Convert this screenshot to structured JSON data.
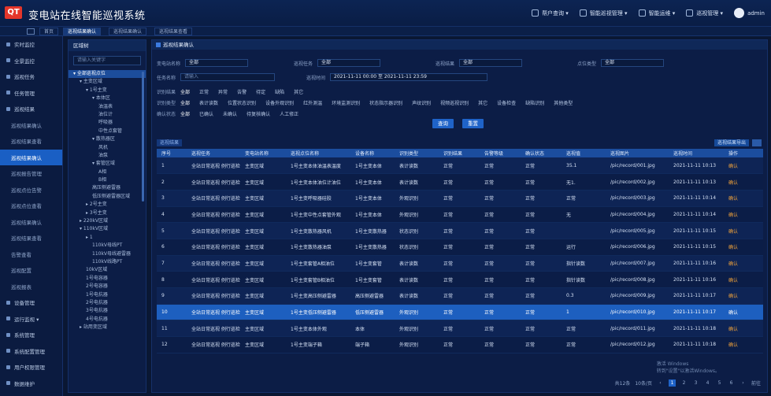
{
  "app": {
    "title": "变电站在线智能巡视系统",
    "logo_text": "QT"
  },
  "topbar": {
    "items": [
      {
        "label": "帮户查询 ▾",
        "icon": "user-icon"
      },
      {
        "label": "智能巡视管理 ▾",
        "icon": "monitor-icon"
      },
      {
        "label": "智能运维 ▾",
        "icon": "tool-icon"
      },
      {
        "label": "巡视管理 ▾",
        "icon": "list-icon"
      }
    ],
    "user": "admin"
  },
  "tabs": [
    "首页",
    "巡视结果确认",
    "巡视结果确认",
    "巡视结果查看"
  ],
  "sidebar": {
    "items": [
      {
        "label": "实时监控",
        "sub": false
      },
      {
        "label": "全景监控",
        "sub": false
      },
      {
        "label": "巡视任务",
        "sub": false
      },
      {
        "label": "任务管理",
        "sub": false
      },
      {
        "label": "巡视结果",
        "sub": false
      },
      {
        "label": "巡视结果确认",
        "sub": true
      },
      {
        "label": "巡视结果查看",
        "sub": true
      },
      {
        "label": "巡视结果确认",
        "sub": true,
        "active": true
      },
      {
        "label": "巡视报告管理",
        "sub": true
      },
      {
        "label": "巡视点位告警",
        "sub": true
      },
      {
        "label": "巡视点位查看",
        "sub": true
      },
      {
        "label": "巡视结果确认",
        "sub": true
      },
      {
        "label": "巡视结果查看",
        "sub": true
      },
      {
        "label": "告警查看",
        "sub": true
      },
      {
        "label": "巡视配置",
        "sub": true
      },
      {
        "label": "巡视报表",
        "sub": true
      },
      {
        "label": "设备管理",
        "sub": false
      },
      {
        "label": "运行监视 ▾",
        "sub": false
      },
      {
        "label": "系统管理",
        "sub": false
      },
      {
        "label": "系统配置管理",
        "sub": false
      },
      {
        "label": "用户权限管理",
        "sub": false
      },
      {
        "label": "数据维护",
        "sub": false
      },
      {
        "label": "帮助中心",
        "sub": false
      }
    ]
  },
  "tree": {
    "title": "区域树",
    "search_placeholder": "请输入关键字",
    "nodes": [
      {
        "label": "▾ 全部巡视点位",
        "level": 0,
        "sel": true
      },
      {
        "label": "▾ 主变区域",
        "level": 1
      },
      {
        "label": "▾ 1号主变",
        "level": 2
      },
      {
        "label": "▾ 本体区",
        "level": 3
      },
      {
        "label": "油温表",
        "level": 4
      },
      {
        "label": "油位计",
        "level": 4
      },
      {
        "label": "呼吸器",
        "level": 4
      },
      {
        "label": "中性点套管",
        "level": 4
      },
      {
        "label": "▾ 散热器区",
        "level": 3
      },
      {
        "label": "风机",
        "level": 4
      },
      {
        "label": "油泵",
        "level": 4
      },
      {
        "label": "▾ 套管区域",
        "level": 3
      },
      {
        "label": "A相",
        "level": 4
      },
      {
        "label": "B相",
        "level": 4
      },
      {
        "label": "高压侧避雷器",
        "level": 3
      },
      {
        "label": "低压侧避雷器区域",
        "level": 3
      },
      {
        "label": "▸ 2号主变",
        "level": 2
      },
      {
        "label": "▸ 3号主变",
        "level": 2
      },
      {
        "label": "▸ 220kV区域",
        "level": 1
      },
      {
        "label": "▾ 110kV区域",
        "level": 1
      },
      {
        "label": "▸ 1",
        "level": 2
      },
      {
        "label": "110kV母线PT",
        "level": 3
      },
      {
        "label": "110kV母线避雷器",
        "level": 3
      },
      {
        "label": "110kV线路PT",
        "level": 3
      },
      {
        "label": "10kV区域",
        "level": 2
      },
      {
        "label": "1号电容器",
        "level": 2
      },
      {
        "label": "2号电容器",
        "level": 2
      },
      {
        "label": "1号电抗器",
        "level": 2
      },
      {
        "label": "2号电抗器",
        "level": 2
      },
      {
        "label": "3号电抗器",
        "level": 2
      },
      {
        "label": "4号电抗器",
        "level": 2
      },
      {
        "label": "▸ 站用变区域",
        "level": 1
      }
    ]
  },
  "main": {
    "panel_title": "巡视结果确认",
    "filters": {
      "row1": [
        {
          "label": "变电站名称",
          "value": "全部"
        },
        {
          "label": "巡视任务",
          "value": "全部"
        },
        {
          "label": "巡视结果",
          "value": "全部"
        },
        {
          "label": "点位类型",
          "value": "全部"
        }
      ],
      "row2": {
        "label": "任务名称",
        "placeholder": "请输入",
        "time_label": "巡视时间",
        "time_value": "2021-11-11 00:00 至 2021-11-11 23:59"
      },
      "row3": {
        "label": "识别结果",
        "chips": [
          "全部",
          "正常",
          "异常",
          "告警",
          "待定",
          "缺陷",
          "其它"
        ]
      },
      "row4": {
        "label": "识别类型",
        "chips": [
          "全部",
          "表计读数",
          "位置状态识别",
          "设备外观识别",
          "红外测温",
          "环境监测识别",
          "状态指示器识别",
          "声纹识别",
          "视频巡视识别",
          "其它",
          "设备检查",
          "缺陷识别",
          "其他类型"
        ]
      },
      "row5": {
        "label": "确认状态",
        "chips": [
          "全部",
          "已确认",
          "未确认",
          "待复核确认",
          "人工修正"
        ]
      },
      "search_label": "查询",
      "reset_label": "重置"
    },
    "table_label": "巡视结果",
    "export_label": "巡视结果导出",
    "columns": [
      "序号",
      "巡视任务",
      "变电站名称",
      "巡视点位名称",
      "设备名称",
      "识别类型",
      "识别结果",
      "告警等级",
      "确认状态",
      "巡视值",
      "巡视图片",
      "巡视时间",
      "操作"
    ],
    "rows": [
      [
        "1",
        "全站日常巡视 例行巡检",
        "主变区域",
        "1号主变本体油温表温度",
        "1号主变本体",
        "表计读数",
        "正常",
        "正常",
        "正常",
        "35.1",
        "/pic/record/001.jpg",
        "2021-11-11 10:13",
        "确认"
      ],
      [
        "2",
        "全站日常巡视 例行巡检",
        "主变区域",
        "1号主变本体油位计油位",
        "1号主变本体",
        "表计读数",
        "正常",
        "正常",
        "正常",
        "无1.",
        "/pic/record/002.jpg",
        "2021-11-11 10:13",
        "确认"
      ],
      [
        "3",
        "全站日常巡视 例行巡检",
        "主变区域",
        "1号主变呼吸器硅胶",
        "1号主变本体",
        "外观识别",
        "正常",
        "正常",
        "正常",
        "正常",
        "/pic/record/003.jpg",
        "2021-11-11 10:14",
        "确认"
      ],
      [
        "4",
        "全站日常巡视 例行巡检",
        "主变区域",
        "1号主变中性点套管外观",
        "1号主变本体",
        "外观识别",
        "正常",
        "正常",
        "正常",
        "无",
        "/pic/record/004.jpg",
        "2021-11-11 10:14",
        "确认"
      ],
      [
        "5",
        "全站日常巡视 例行巡检",
        "主变区域",
        "1号主变散热器风机",
        "1号主变散热器",
        "状态识别",
        "正常",
        "正常",
        "正常",
        "",
        "/pic/record/005.jpg",
        "2021-11-11 10:15",
        "确认"
      ],
      [
        "6",
        "全站日常巡视 例行巡检",
        "主变区域",
        "1号主变散热器油泵",
        "1号主变散热器",
        "状态识别",
        "正常",
        "正常",
        "正常",
        "运行",
        "/pic/record/006.jpg",
        "2021-11-11 10:15",
        "确认"
      ],
      [
        "7",
        "全站日常巡视 例行巡检",
        "主变区域",
        "1号主变套管A相油位",
        "1号主变套管",
        "表计读数",
        "正常",
        "正常",
        "正常",
        "指针读数",
        "/pic/record/007.jpg",
        "2021-11-11 10:16",
        "确认"
      ],
      [
        "8",
        "全站日常巡视 例行巡检",
        "主变区域",
        "1号主变套管B相油位",
        "1号主变套管",
        "表计读数",
        "正常",
        "正常",
        "正常",
        "指针读数",
        "/pic/record/008.jpg",
        "2021-11-11 10:16",
        "确认"
      ],
      [
        "9",
        "全站日常巡视 例行巡检",
        "主变区域",
        "1号主变高压侧避雷器",
        "高压侧避雷器",
        "表计读数",
        "正常",
        "正常",
        "正常",
        "0.3",
        "/pic/record/009.jpg",
        "2021-11-11 10:17",
        "确认"
      ],
      [
        "10",
        "全站日常巡视 例行巡检",
        "主变区域",
        "1号主变低压侧避雷器",
        "低压侧避雷器",
        "外观识别",
        "正常",
        "正常",
        "正常",
        "1",
        "/pic/record/010.jpg",
        "2021-11-11 10:17",
        "确认"
      ],
      [
        "11",
        "全站日常巡视 例行巡检",
        "主变区域",
        "1号主变本体外观",
        "本体",
        "外观识别",
        "正常",
        "正常",
        "正常",
        "正常",
        "/pic/record/011.jpg",
        "2021-11-11 10:18",
        "确认"
      ],
      [
        "12",
        "全站日常巡视 例行巡检",
        "主变区域",
        "1号主变端子箱",
        "端子箱",
        "外观识别",
        "正常",
        "正常",
        "正常",
        "正常",
        "/pic/record/012.jpg",
        "2021-11-11 10:18",
        "确认"
      ]
    ],
    "watermark": [
      "激活 Windows",
      "转到\"设置\"以激活Windows。"
    ],
    "pager": {
      "total": "共12条",
      "size": "10条/页",
      "pages": [
        "‹",
        "1",
        "2",
        "3",
        "4",
        "5",
        "6",
        "›"
      ],
      "current": "1",
      "goto": "前往"
    }
  }
}
